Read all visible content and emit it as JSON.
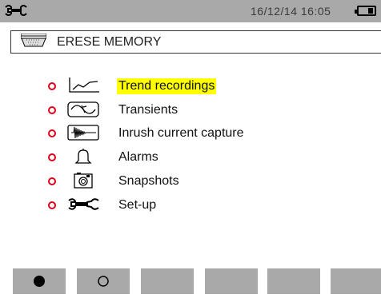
{
  "status_bar": {
    "datetime": "16/12/14  16:05"
  },
  "title_bar": {
    "title": "ERESE MEMORY"
  },
  "menu": [
    {
      "label": "Trend recordings",
      "icon": "trend-icon",
      "selected": true
    },
    {
      "label": "Transients",
      "icon": "transients-icon",
      "selected": false
    },
    {
      "label": "Inrush current capture",
      "icon": "inrush-icon",
      "selected": false
    },
    {
      "label": "Alarms",
      "icon": "alarm-bell-icon",
      "selected": false
    },
    {
      "label": "Snapshots",
      "icon": "camera-icon",
      "selected": false
    },
    {
      "label": "Set-up",
      "icon": "wrench-icon",
      "selected": false
    }
  ],
  "softkeys": [
    {
      "symbol": "●"
    },
    {
      "symbol": "○"
    },
    {
      "symbol": ""
    },
    {
      "symbol": ""
    },
    {
      "symbol": ""
    },
    {
      "symbol": ""
    }
  ],
  "colors": {
    "bar": "#a9a9a9",
    "highlight": "#ffff00",
    "bullet": "#e0001a"
  }
}
